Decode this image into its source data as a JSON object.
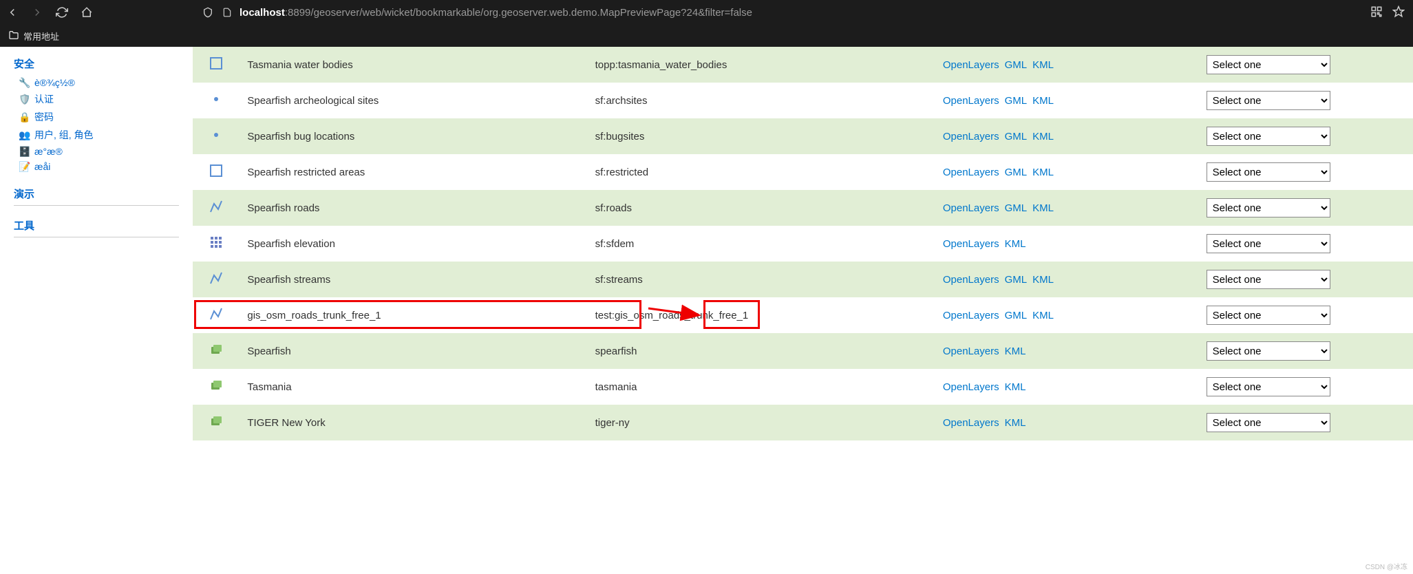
{
  "url": {
    "host": "localhost",
    "rest": ":8899/geoserver/web/wicket/bookmarkable/org.geoserver.web.demo.MapPreviewPage?24&filter=false"
  },
  "bookmarks": {
    "common": "常用地址"
  },
  "sidebar": {
    "security_header": "安全",
    "items": [
      {
        "icon": "wrench",
        "label": "è®¾ç½®"
      },
      {
        "icon": "shield",
        "label": "认证"
      },
      {
        "icon": "lock",
        "label": "密码"
      },
      {
        "icon": "users",
        "label": "用户, 组, 角色"
      },
      {
        "icon": "db",
        "label": "æ°æ®"
      },
      {
        "icon": "note",
        "label": "æåi"
      }
    ],
    "demo_header": "演示",
    "tools_header": "工具"
  },
  "select_placeholder": "Select one",
  "rows": [
    {
      "type": "polygon",
      "title": "Tasmania water bodies",
      "name": "topp:tasmania_water_bodies",
      "ol": "OpenLayers",
      "gml": "GML",
      "kml": "KML"
    },
    {
      "type": "point",
      "title": "Spearfish archeological sites",
      "name": "sf:archsites",
      "ol": "OpenLayers",
      "gml": "GML",
      "kml": "KML"
    },
    {
      "type": "point",
      "title": "Spearfish bug locations",
      "name": "sf:bugsites",
      "ol": "OpenLayers",
      "gml": "GML",
      "kml": "KML"
    },
    {
      "type": "polygon",
      "title": "Spearfish restricted areas",
      "name": "sf:restricted",
      "ol": "OpenLayers",
      "gml": "GML",
      "kml": "KML"
    },
    {
      "type": "line",
      "title": "Spearfish roads",
      "name": "sf:roads",
      "ol": "OpenLayers",
      "gml": "GML",
      "kml": "KML"
    },
    {
      "type": "raster",
      "title": "Spearfish elevation",
      "name": "sf:sfdem",
      "ol": "OpenLayers",
      "gml": "",
      "kml": "KML"
    },
    {
      "type": "line",
      "title": "Spearfish streams",
      "name": "sf:streams",
      "ol": "OpenLayers",
      "gml": "GML",
      "kml": "KML"
    },
    {
      "type": "line",
      "title": "gis_osm_roads_trunk_free_1",
      "name": "test:gis_osm_roads_trunk_free_1",
      "ol": "OpenLayers",
      "gml": "GML",
      "kml": "KML"
    },
    {
      "type": "group",
      "title": "Spearfish",
      "name": "spearfish",
      "ol": "OpenLayers",
      "gml": "",
      "kml": "KML"
    },
    {
      "type": "group",
      "title": "Tasmania",
      "name": "tasmania",
      "ol": "OpenLayers",
      "gml": "",
      "kml": "KML"
    },
    {
      "type": "group",
      "title": "TIGER New York",
      "name": "tiger-ny",
      "ol": "OpenLayers",
      "gml": "",
      "kml": "KML"
    }
  ],
  "watermark": "CSDN @冰冻"
}
